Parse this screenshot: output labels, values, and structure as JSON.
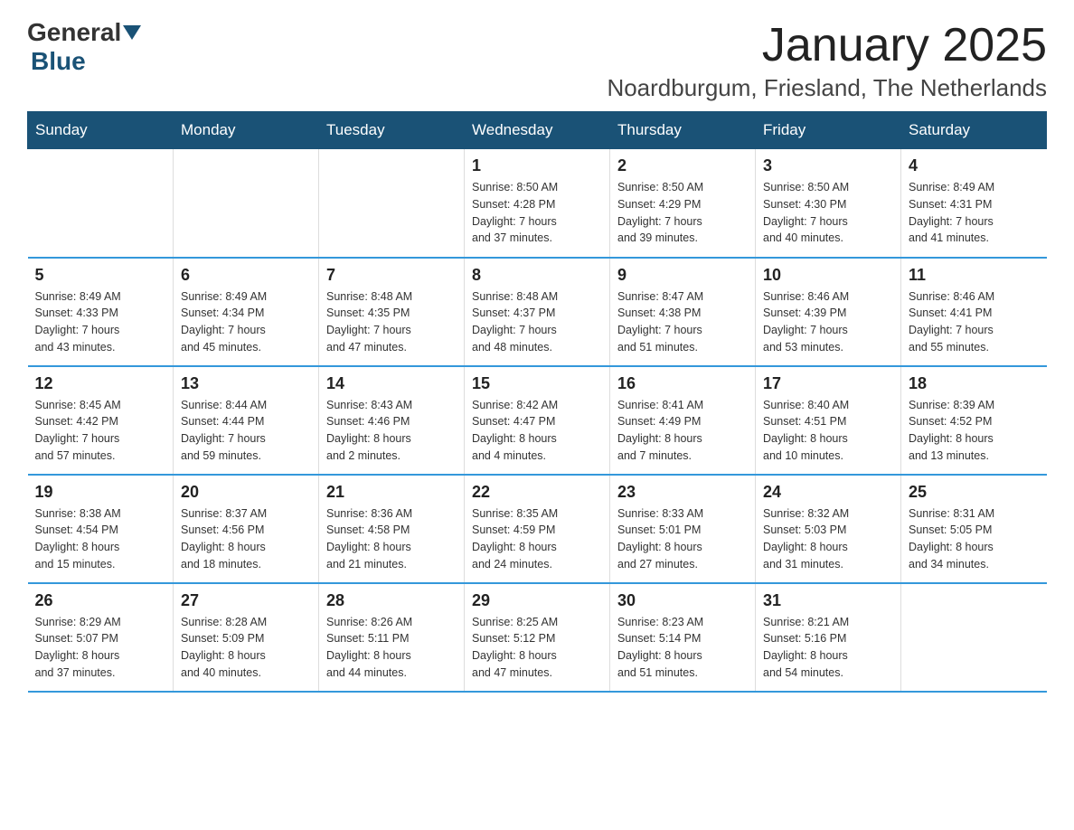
{
  "logo": {
    "general": "General",
    "blue": "Blue"
  },
  "title": "January 2025",
  "location": "Noardburgum, Friesland, The Netherlands",
  "days_of_week": [
    "Sunday",
    "Monday",
    "Tuesday",
    "Wednesday",
    "Thursday",
    "Friday",
    "Saturday"
  ],
  "weeks": [
    [
      {
        "day": "",
        "info": ""
      },
      {
        "day": "",
        "info": ""
      },
      {
        "day": "",
        "info": ""
      },
      {
        "day": "1",
        "info": "Sunrise: 8:50 AM\nSunset: 4:28 PM\nDaylight: 7 hours\nand 37 minutes."
      },
      {
        "day": "2",
        "info": "Sunrise: 8:50 AM\nSunset: 4:29 PM\nDaylight: 7 hours\nand 39 minutes."
      },
      {
        "day": "3",
        "info": "Sunrise: 8:50 AM\nSunset: 4:30 PM\nDaylight: 7 hours\nand 40 minutes."
      },
      {
        "day": "4",
        "info": "Sunrise: 8:49 AM\nSunset: 4:31 PM\nDaylight: 7 hours\nand 41 minutes."
      }
    ],
    [
      {
        "day": "5",
        "info": "Sunrise: 8:49 AM\nSunset: 4:33 PM\nDaylight: 7 hours\nand 43 minutes."
      },
      {
        "day": "6",
        "info": "Sunrise: 8:49 AM\nSunset: 4:34 PM\nDaylight: 7 hours\nand 45 minutes."
      },
      {
        "day": "7",
        "info": "Sunrise: 8:48 AM\nSunset: 4:35 PM\nDaylight: 7 hours\nand 47 minutes."
      },
      {
        "day": "8",
        "info": "Sunrise: 8:48 AM\nSunset: 4:37 PM\nDaylight: 7 hours\nand 48 minutes."
      },
      {
        "day": "9",
        "info": "Sunrise: 8:47 AM\nSunset: 4:38 PM\nDaylight: 7 hours\nand 51 minutes."
      },
      {
        "day": "10",
        "info": "Sunrise: 8:46 AM\nSunset: 4:39 PM\nDaylight: 7 hours\nand 53 minutes."
      },
      {
        "day": "11",
        "info": "Sunrise: 8:46 AM\nSunset: 4:41 PM\nDaylight: 7 hours\nand 55 minutes."
      }
    ],
    [
      {
        "day": "12",
        "info": "Sunrise: 8:45 AM\nSunset: 4:42 PM\nDaylight: 7 hours\nand 57 minutes."
      },
      {
        "day": "13",
        "info": "Sunrise: 8:44 AM\nSunset: 4:44 PM\nDaylight: 7 hours\nand 59 minutes."
      },
      {
        "day": "14",
        "info": "Sunrise: 8:43 AM\nSunset: 4:46 PM\nDaylight: 8 hours\nand 2 minutes."
      },
      {
        "day": "15",
        "info": "Sunrise: 8:42 AM\nSunset: 4:47 PM\nDaylight: 8 hours\nand 4 minutes."
      },
      {
        "day": "16",
        "info": "Sunrise: 8:41 AM\nSunset: 4:49 PM\nDaylight: 8 hours\nand 7 minutes."
      },
      {
        "day": "17",
        "info": "Sunrise: 8:40 AM\nSunset: 4:51 PM\nDaylight: 8 hours\nand 10 minutes."
      },
      {
        "day": "18",
        "info": "Sunrise: 8:39 AM\nSunset: 4:52 PM\nDaylight: 8 hours\nand 13 minutes."
      }
    ],
    [
      {
        "day": "19",
        "info": "Sunrise: 8:38 AM\nSunset: 4:54 PM\nDaylight: 8 hours\nand 15 minutes."
      },
      {
        "day": "20",
        "info": "Sunrise: 8:37 AM\nSunset: 4:56 PM\nDaylight: 8 hours\nand 18 minutes."
      },
      {
        "day": "21",
        "info": "Sunrise: 8:36 AM\nSunset: 4:58 PM\nDaylight: 8 hours\nand 21 minutes."
      },
      {
        "day": "22",
        "info": "Sunrise: 8:35 AM\nSunset: 4:59 PM\nDaylight: 8 hours\nand 24 minutes."
      },
      {
        "day": "23",
        "info": "Sunrise: 8:33 AM\nSunset: 5:01 PM\nDaylight: 8 hours\nand 27 minutes."
      },
      {
        "day": "24",
        "info": "Sunrise: 8:32 AM\nSunset: 5:03 PM\nDaylight: 8 hours\nand 31 minutes."
      },
      {
        "day": "25",
        "info": "Sunrise: 8:31 AM\nSunset: 5:05 PM\nDaylight: 8 hours\nand 34 minutes."
      }
    ],
    [
      {
        "day": "26",
        "info": "Sunrise: 8:29 AM\nSunset: 5:07 PM\nDaylight: 8 hours\nand 37 minutes."
      },
      {
        "day": "27",
        "info": "Sunrise: 8:28 AM\nSunset: 5:09 PM\nDaylight: 8 hours\nand 40 minutes."
      },
      {
        "day": "28",
        "info": "Sunrise: 8:26 AM\nSunset: 5:11 PM\nDaylight: 8 hours\nand 44 minutes."
      },
      {
        "day": "29",
        "info": "Sunrise: 8:25 AM\nSunset: 5:12 PM\nDaylight: 8 hours\nand 47 minutes."
      },
      {
        "day": "30",
        "info": "Sunrise: 8:23 AM\nSunset: 5:14 PM\nDaylight: 8 hours\nand 51 minutes."
      },
      {
        "day": "31",
        "info": "Sunrise: 8:21 AM\nSunset: 5:16 PM\nDaylight: 8 hours\nand 54 minutes."
      },
      {
        "day": "",
        "info": ""
      }
    ]
  ]
}
